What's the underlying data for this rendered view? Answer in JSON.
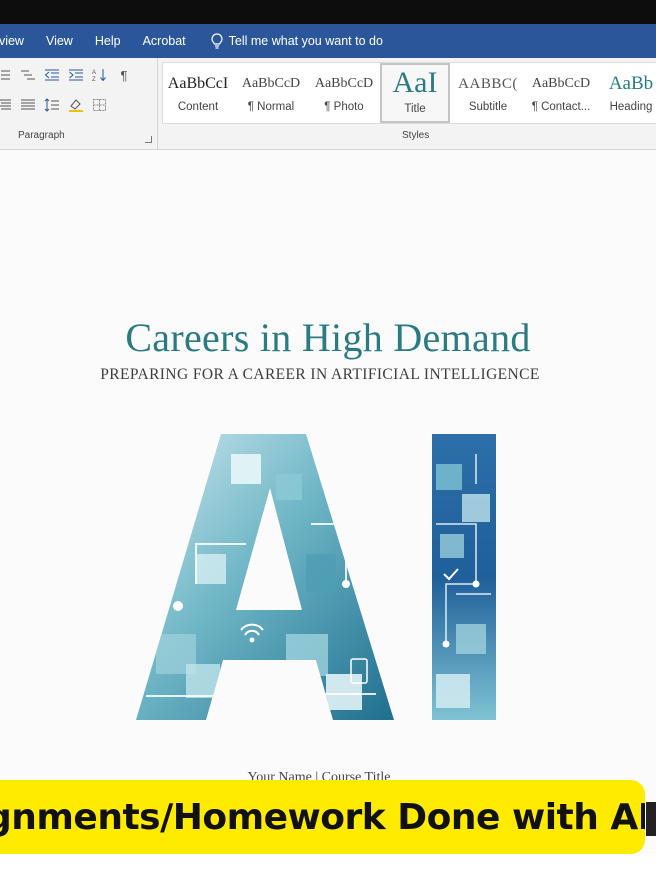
{
  "ribbon_tabs": [
    "eview",
    "View",
    "Help",
    "Acrobat"
  ],
  "tell_me": "Tell me what you want to do",
  "paragraph_group": {
    "label": "Paragraph"
  },
  "styles_group": {
    "label": "Styles",
    "items": [
      {
        "preview": "AaBbCcI",
        "name": "Content"
      },
      {
        "preview": "AaBbCcD",
        "name": "¶ Normal"
      },
      {
        "preview": "AaBbCcD",
        "name": "¶ Photo"
      },
      {
        "preview": "AaI",
        "name": "Title"
      },
      {
        "preview": "AABBC(",
        "name": "Subtitle"
      },
      {
        "preview": "AaBbCcD",
        "name": "¶ Contact..."
      },
      {
        "preview": "AaBb",
        "name": "Heading"
      }
    ],
    "selected": "Title"
  },
  "document": {
    "title": "Careers in High Demand",
    "subtitle": "PREPARING FOR A CAREER IN ARTIFICIAL INTELLIGENCE",
    "graphic_text": "AI",
    "footer": "Your Name | Course Title"
  },
  "banner": {
    "text": "gnments/Homework Done with AHB"
  },
  "colors": {
    "ribbon_blue": "#2b579a",
    "title_teal": "#2a7b82",
    "banner_yellow": "#ffeb00"
  }
}
